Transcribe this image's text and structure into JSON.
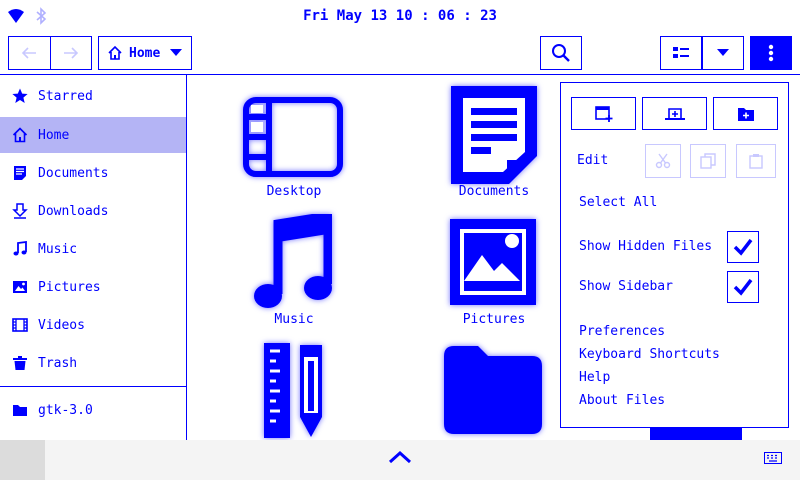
{
  "status_bar": {
    "clock": "Fri May 13 10 : 06 : 23"
  },
  "header": {
    "path_label": "Home"
  },
  "sidebar": {
    "items": [
      {
        "label": "Starred",
        "icon": "star-icon"
      },
      {
        "label": "Home",
        "icon": "home-icon",
        "selected": true
      },
      {
        "label": "Documents",
        "icon": "document-icon"
      },
      {
        "label": "Downloads",
        "icon": "download-icon"
      },
      {
        "label": "Music",
        "icon": "music-note-icon"
      },
      {
        "label": "Pictures",
        "icon": "picture-icon"
      },
      {
        "label": "Videos",
        "icon": "film-icon"
      },
      {
        "label": "Trash",
        "icon": "trash-icon"
      }
    ],
    "bookmarks": [
      {
        "label": "gtk-3.0",
        "icon": "folder-icon"
      }
    ]
  },
  "files": [
    {
      "label": "Desktop",
      "icon": "desktop-folder-icon"
    },
    {
      "label": "Documents",
      "icon": "documents-folder-icon"
    },
    {
      "label": "Music",
      "icon": "music-folder-icon"
    },
    {
      "label": "Pictures",
      "icon": "pictures-folder-icon"
    },
    {
      "label": "",
      "icon": "templates-folder-icon"
    },
    {
      "label": "",
      "icon": "folder-icon"
    }
  ],
  "menu": {
    "edit_label": "Edit",
    "select_all": "Select All",
    "show_hidden": "Show Hidden Files",
    "show_hidden_checked": true,
    "show_sidebar": "Show Sidebar",
    "show_sidebar_checked": true,
    "preferences": "Preferences",
    "shortcuts": "Keyboard Shortcuts",
    "help": "Help",
    "about": "About Files"
  },
  "colors": {
    "accent": "#0000ff",
    "selection": "#b4b4f5",
    "disabled": "#c8c8ff"
  }
}
